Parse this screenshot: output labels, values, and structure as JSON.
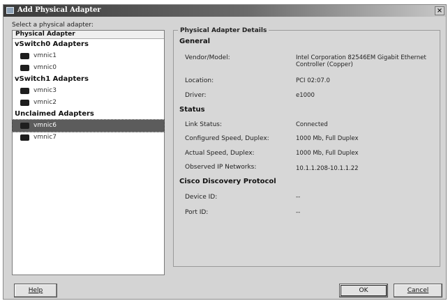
{
  "window": {
    "title": "Add Physical Adapter",
    "close_glyph": "×"
  },
  "prompt": "Select a physical adapter:",
  "list": {
    "header": "Physical Adapter",
    "groups": [
      {
        "label": "vSwitch0 Adapters",
        "items": [
          {
            "label": "vmnic1"
          },
          {
            "label": "vmnic0"
          }
        ]
      },
      {
        "label": "vSwitch1 Adapters",
        "items": [
          {
            "label": "vmnic3"
          },
          {
            "label": "vmnic2"
          }
        ]
      },
      {
        "label": "Unclaimed Adapters",
        "items": [
          {
            "label": "vmnic6",
            "selected": true
          },
          {
            "label": "vmnic7"
          }
        ]
      }
    ]
  },
  "details": {
    "title": "Physical Adapter Details",
    "general": {
      "heading": "General",
      "vendor_label": "Vendor/Model:",
      "vendor_value": "Intel Corporation 82546EM Gigabit Ethernet Controller (Copper)",
      "location_label": "Location:",
      "location_value": "PCI 02:07.0",
      "driver_label": "Driver:",
      "driver_value": "e1000"
    },
    "status": {
      "heading": "Status",
      "link_label": "Link Status:",
      "link_value": "Connected",
      "configured_label": "Configured Speed, Duplex:",
      "configured_value": "1000 Mb, Full Duplex",
      "actual_label": "Actual Speed, Duplex:",
      "actual_value": "1000 Mb, Full Duplex",
      "observed_label": "Observed IP Networks:",
      "observed_value": "10.1.1.208-10.1.1.22"
    },
    "cdp": {
      "heading": "Cisco Discovery Protocol",
      "device_label": "Device ID:",
      "device_value": "--",
      "port_label": "Port ID:",
      "port_value": "--"
    }
  },
  "buttons": {
    "help": "Help",
    "ok": "OK",
    "cancel": "Cancel"
  },
  "icons": {
    "adapter": "network-adapter-icon",
    "window": "window-icon"
  }
}
